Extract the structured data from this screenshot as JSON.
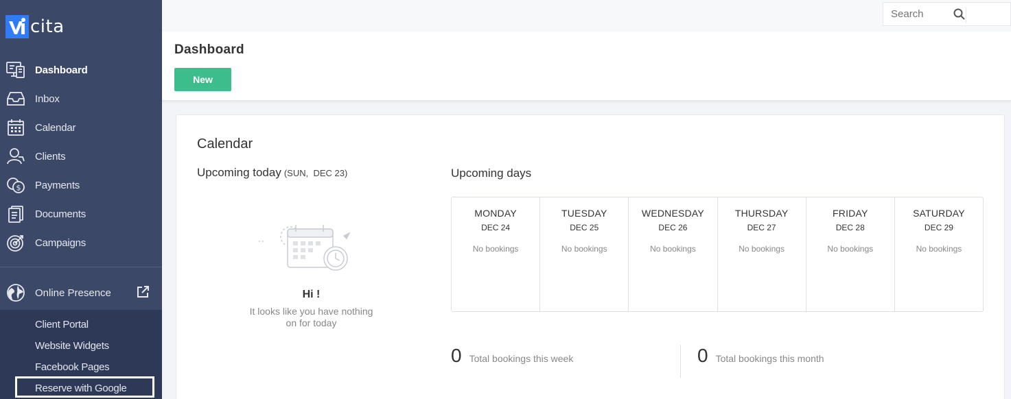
{
  "brand": {
    "name": "cita",
    "mark": "v"
  },
  "sidebar": {
    "items": [
      {
        "label": "Dashboard",
        "icon": "dashboard-icon",
        "active": true
      },
      {
        "label": "Inbox",
        "icon": "inbox-icon"
      },
      {
        "label": "Calendar",
        "icon": "calendar-icon"
      },
      {
        "label": "Clients",
        "icon": "clients-icon"
      },
      {
        "label": "Payments",
        "icon": "payments-icon"
      },
      {
        "label": "Documents",
        "icon": "documents-icon"
      },
      {
        "label": "Campaigns",
        "icon": "campaigns-icon"
      }
    ],
    "online_presence": {
      "label": "Online Presence",
      "icon": "globe-icon",
      "action_icon": "external-link-icon"
    },
    "sub_items": [
      {
        "label": "Client Portal"
      },
      {
        "label": "Website Widgets"
      },
      {
        "label": "Facebook Pages"
      },
      {
        "label": "Reserve with Google"
      }
    ]
  },
  "topbar": {
    "search_placeholder": "Search"
  },
  "header": {
    "title": "Dashboard",
    "new_button": "New"
  },
  "calendar": {
    "title": "Calendar",
    "today_label": "Upcoming today",
    "today_date": "(SUN,  DEC 23)",
    "empty_title": "Hi !",
    "empty_message": "It looks like you have nothing on for today",
    "upcoming_label": "Upcoming days",
    "days": [
      {
        "name": "MONDAY",
        "date": "DEC 24",
        "status": "No bookings"
      },
      {
        "name": "TUESDAY",
        "date": "DEC 25",
        "status": "No bookings"
      },
      {
        "name": "WEDNESDAY",
        "date": "DEC 26",
        "status": "No bookings"
      },
      {
        "name": "THURSDAY",
        "date": "DEC 27",
        "status": "No bookings"
      },
      {
        "name": "FRIDAY",
        "date": "DEC 28",
        "status": "No bookings"
      },
      {
        "name": "SATURDAY",
        "date": "DEC 29",
        "status": "No bookings"
      }
    ],
    "totals": {
      "week": {
        "value": "0",
        "label": "Total bookings this week"
      },
      "month": {
        "value": "0",
        "label": "Total bookings this month"
      }
    }
  },
  "colors": {
    "sidebar": "#3b4868",
    "sidebar_sub": "#2d3956",
    "accent": "#3ebd8c",
    "brand": "#2f7cf6"
  }
}
